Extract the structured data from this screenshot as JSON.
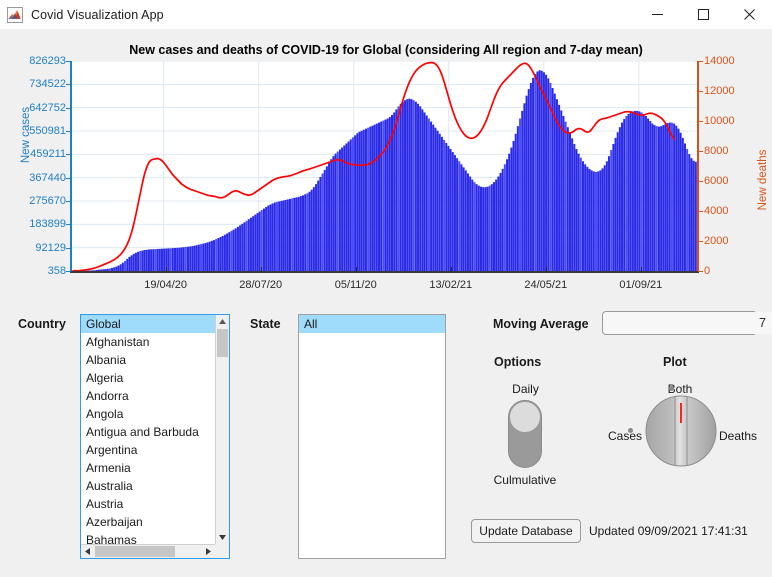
{
  "window": {
    "title": "Covid Visualization App",
    "icon": "matlab-app-icon",
    "minimize_label": "—",
    "maximize_label": "❑",
    "close_label": "✕"
  },
  "chart_data": {
    "type": "bar",
    "title": "New cases and deaths of COVID-19 for Global (considering All region and 7-day mean)",
    "xlabel": "",
    "ylabel": "New cases",
    "y2label": "New deaths",
    "grid": true,
    "legend_position": "none",
    "x_tick_labels": [
      "19/04/20",
      "28/07/20",
      "05/11/20",
      "13/02/21",
      "24/05/21",
      "01/09/21"
    ],
    "y_tick_labels": [
      "826293",
      "734522",
      "642752",
      "550981",
      "459211",
      "367440",
      "275670",
      "183899",
      "92129",
      "358"
    ],
    "ylim": [
      358,
      826293
    ],
    "y2_tick_labels": [
      "14000",
      "12000",
      "10000",
      "8000",
      "6000",
      "4000",
      "2000",
      "0"
    ],
    "y2lim": [
      0,
      14000
    ],
    "series": [
      {
        "name": "New cases",
        "type": "bar",
        "color": "#2929e8",
        "axis": "left",
        "values": [
          300,
          400,
          500,
          700,
          900,
          1200,
          1500,
          1900,
          2400,
          3000,
          3800,
          4600,
          5500,
          6400,
          7200,
          8000,
          9000,
          10500,
          12500,
          15000,
          18000,
          22000,
          27000,
          33000,
          40000,
          48000,
          56000,
          62000,
          68000,
          72000,
          76000,
          79000,
          81000,
          83000,
          84000,
          85000,
          85500,
          86000,
          86500,
          87000,
          87500,
          88000,
          88500,
          89000,
          89500,
          90000,
          90500,
          91000,
          91500,
          92000,
          93000,
          94000,
          95000,
          96000,
          97000,
          98000,
          100000,
          102000,
          104000,
          106000,
          108000,
          110000,
          113000,
          116000,
          119000,
          122000,
          126000,
          130000,
          134000,
          138000,
          143000,
          148000,
          153000,
          158000,
          163000,
          168000,
          174000,
          180000,
          186000,
          192000,
          198000,
          204000,
          210000,
          216000,
          222000,
          228000,
          234000,
          240000,
          246000,
          252000,
          258000,
          262000,
          266000,
          270000,
          272000,
          274000,
          276000,
          278000,
          280000,
          282000,
          284000,
          286000,
          288000,
          290000,
          292000,
          295000,
          298000,
          302000,
          306000,
          312000,
          320000,
          330000,
          342000,
          356000,
          370000,
          384000,
          398000,
          412000,
          426000,
          440000,
          452000,
          462000,
          470000,
          478000,
          486000,
          494000,
          502000,
          510000,
          518000,
          526000,
          534000,
          542000,
          548000,
          552000,
          556000,
          560000,
          564000,
          568000,
          572000,
          576000,
          580000,
          584000,
          588000,
          592000,
          596000,
          600000,
          606000,
          614000,
          624000,
          636000,
          648000,
          658000,
          666000,
          672000,
          676000,
          678000,
          676000,
          672000,
          666000,
          658000,
          648000,
          636000,
          624000,
          612000,
          600000,
          588000,
          576000,
          564000,
          552000,
          540000,
          528000,
          516000,
          504000,
          492000,
          480000,
          468000,
          456000,
          444000,
          432000,
          420000,
          408000,
          396000,
          384000,
          372000,
          360000,
          350000,
          342000,
          336000,
          332000,
          330000,
          330000,
          332000,
          336000,
          342000,
          350000,
          360000,
          372000,
          386000,
          402000,
          420000,
          440000,
          462000,
          486000,
          512000,
          540000,
          570000,
          600000,
          630000,
          660000,
          690000,
          716000,
          740000,
          760000,
          775000,
          785000,
          790000,
          788000,
          782000,
          772000,
          758000,
          740000,
          720000,
          698000,
          676000,
          654000,
          632000,
          610000,
          588000,
          566000,
          544000,
          522000,
          500000,
          480000,
          462000,
          446000,
          432000,
          420000,
          410000,
          402000,
          396000,
          392000,
          390000,
          392000,
          396000,
          404000,
          416000,
          432000,
          452000,
          476000,
          500000,
          524000,
          546000,
          566000,
          584000,
          598000,
          610000,
          618000,
          624000,
          628000,
          630000,
          630000,
          628000,
          624000,
          618000,
          610000,
          600000,
          590000,
          580000,
          574000,
          570000,
          568000,
          570000,
          574000,
          578000,
          582000,
          584000,
          584000,
          580000,
          572000,
          560000,
          544000,
          524000,
          502000,
          480000,
          460000,
          444000,
          434000,
          430000
        ]
      },
      {
        "name": "New deaths",
        "type": "line",
        "color": "#ff0000",
        "axis": "right",
        "values": [
          10,
          15,
          20,
          30,
          45,
          60,
          80,
          100,
          130,
          160,
          200,
          250,
          300,
          360,
          420,
          480,
          540,
          600,
          680,
          760,
          860,
          980,
          1120,
          1300,
          1520,
          1800,
          2150,
          2600,
          3150,
          3800,
          4500,
          5200,
          5900,
          6500,
          6950,
          7250,
          7400,
          7450,
          7480,
          7500,
          7450,
          7350,
          7200,
          7000,
          6800,
          6600,
          6400,
          6250,
          6100,
          5950,
          5800,
          5700,
          5600,
          5520,
          5450,
          5400,
          5350,
          5300,
          5250,
          5200,
          5150,
          5100,
          5050,
          5020,
          5000,
          4980,
          4950,
          4900,
          4880,
          4900,
          4950,
          5050,
          5150,
          5250,
          5320,
          5350,
          5320,
          5250,
          5180,
          5120,
          5080,
          5060,
          5080,
          5150,
          5250,
          5350,
          5450,
          5550,
          5650,
          5750,
          5850,
          5950,
          6050,
          6120,
          6180,
          6220,
          6250,
          6280,
          6300,
          6320,
          6350,
          6400,
          6450,
          6500,
          6560,
          6620,
          6680,
          6720,
          6760,
          6800,
          6850,
          6900,
          6950,
          7000,
          7050,
          7100,
          7150,
          7200,
          7250,
          7300,
          7350,
          7400,
          7420,
          7400,
          7350,
          7280,
          7200,
          7150,
          7120,
          7100,
          7080,
          7060,
          7050,
          7050,
          7060,
          7080,
          7120,
          7180,
          7260,
          7360,
          7480,
          7620,
          7780,
          7950,
          8150,
          8400,
          8700,
          9050,
          9450,
          9900,
          10400,
          10900,
          11400,
          11850,
          12250,
          12600,
          12900,
          13150,
          13350,
          13500,
          13620,
          13720,
          13800,
          13850,
          13880,
          13900,
          13880,
          13800,
          13650,
          13400,
          13050,
          12600,
          12100,
          11600,
          11100,
          10650,
          10250,
          9900,
          9600,
          9350,
          9150,
          9000,
          8900,
          8850,
          8850,
          8900,
          9000,
          9150,
          9350,
          9600,
          9900,
          10250,
          10650,
          11050,
          11450,
          11800,
          12100,
          12350,
          12550,
          12700,
          12850,
          13000,
          13150,
          13300,
          13450,
          13600,
          13720,
          13800,
          13850,
          13820,
          13700,
          13500,
          13250,
          12950,
          12650,
          12350,
          12050,
          11750,
          11450,
          11150,
          10850,
          10550,
          10250,
          9950,
          9700,
          9500,
          9350,
          9250,
          9200,
          9200,
          9250,
          9350,
          9450,
          9500,
          9480,
          9400,
          9300,
          9250,
          9300,
          9450,
          9650,
          9850,
          10000,
          10100,
          10150,
          10180,
          10200,
          10250,
          10300,
          10350,
          10400,
          10450,
          10500,
          10550,
          10600,
          10620,
          10620,
          10600,
          10560,
          10500,
          10450,
          10400,
          10380,
          10400,
          10450,
          10500,
          10520,
          10500,
          10450,
          10380,
          10300,
          10200,
          10050,
          9850,
          9600,
          9300,
          9000,
          8800
        ]
      }
    ]
  },
  "country": {
    "label": "Country",
    "selected": "Global",
    "items": [
      "Global",
      "Afghanistan",
      "Albania",
      "Algeria",
      "Andorra",
      "Angola",
      "Antigua and Barbuda",
      "Argentina",
      "Armenia",
      "Australia",
      "Austria",
      "Azerbaijan",
      "Bahamas"
    ]
  },
  "state": {
    "label": "State",
    "selected": "All",
    "items": [
      "All"
    ]
  },
  "moving_average": {
    "label": "Moving Average",
    "value": "7",
    "up_icon": "chevron-up-icon",
    "down_icon": "chevron-down-icon"
  },
  "options": {
    "label": "Options",
    "top_label": "Daily",
    "bottom_label": "Culmulative",
    "selected": "Daily"
  },
  "plot": {
    "label": "Plot",
    "top_label": "Both",
    "left_label": "Cases",
    "right_label": "Deaths",
    "selected": "Both",
    "indicator_color": "#ff0000"
  },
  "database": {
    "button_label": "Update Database",
    "status_text": "Updated 09/09/2021 17:41:31"
  },
  "colors": {
    "cases": "#2929e8",
    "deaths": "#ff0000",
    "left_axis": "#1f7fc4",
    "right_axis": "#d95319",
    "selection": "#9fdbfa",
    "window_bg": "#f0f0f0"
  }
}
